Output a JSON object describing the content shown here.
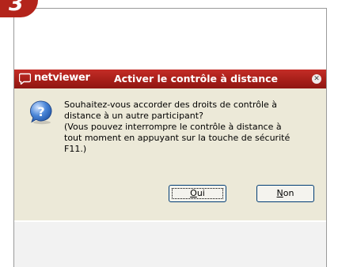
{
  "step": {
    "number": "3"
  },
  "dialog": {
    "app_name": "netviewer",
    "title": "Activer le contrôle à distance",
    "message_lines": [
      "Souhaitez-vous accorder des droits de contrôle à",
      "distance à un autre participant?",
      "(Vous pouvez interrompre le contrôle à distance à",
      "tout moment en appuyant sur la touche de sécurité",
      "F11.)"
    ],
    "buttons": {
      "yes": {
        "mnemonic": "O",
        "rest": "ui"
      },
      "no": {
        "mnemonic": "N",
        "rest": "on"
      }
    }
  },
  "colors": {
    "titlebar": "#a71f19",
    "badge": "#b3241b",
    "dialog_bg": "#ece9d8"
  },
  "icons": {
    "close": "close-icon",
    "question": "question-icon",
    "logo": "speech-bubble-icon"
  }
}
